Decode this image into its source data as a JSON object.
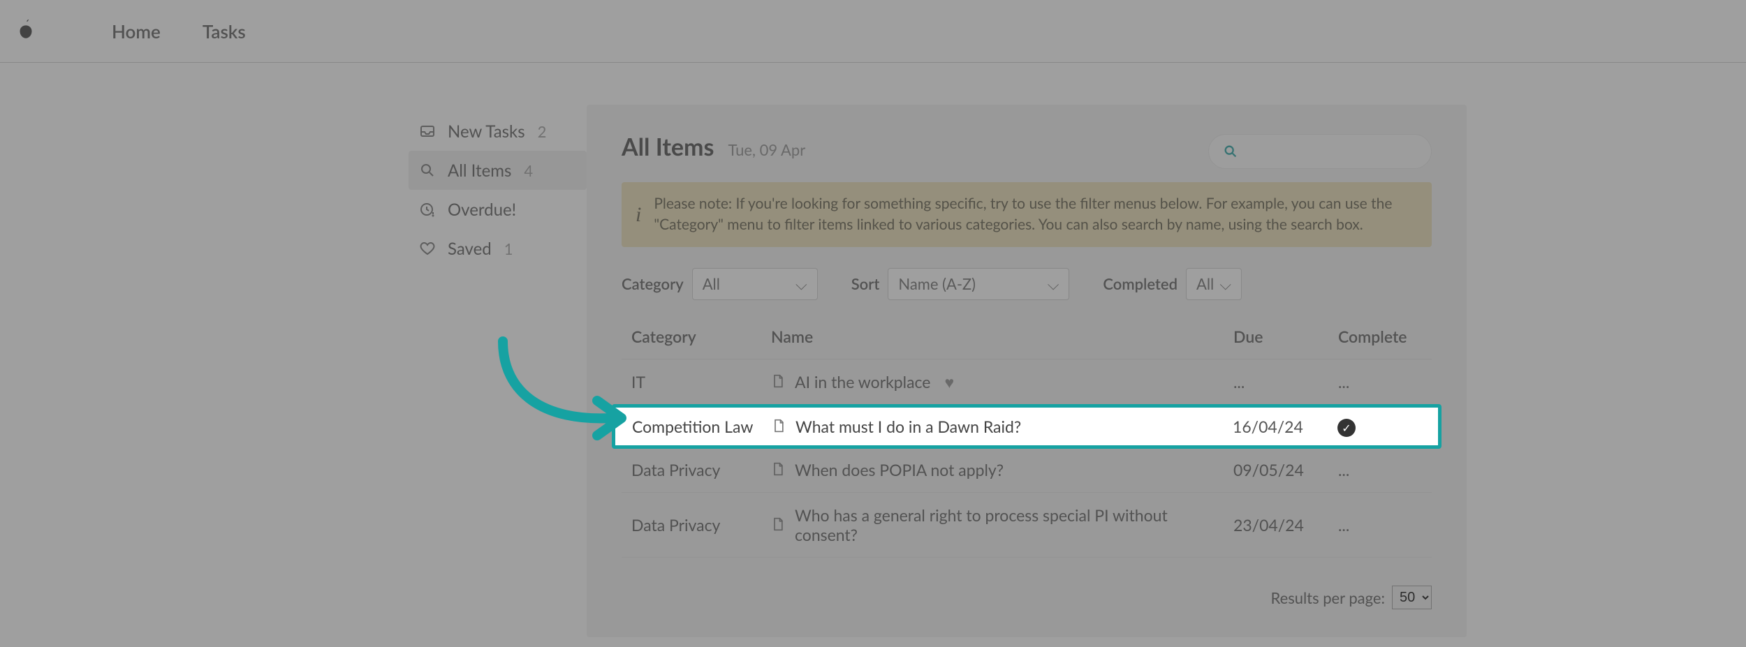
{
  "nav": {
    "home": "Home",
    "tasks": "Tasks"
  },
  "sidebar": {
    "items": [
      {
        "label": "New Tasks",
        "count": "2"
      },
      {
        "label": "All Items",
        "count": "4"
      },
      {
        "label": "Overdue!",
        "count": ""
      },
      {
        "label": "Saved",
        "count": "1"
      }
    ]
  },
  "page": {
    "title": "All Items",
    "date": "Tue, 09 Apr"
  },
  "banner": "Please note: If you're looking for something specific, try to use the filter menus below. For example, you can use the \"Category\" menu to filter items linked to various categories. You can also search by name, using the search box.",
  "filters": {
    "category_label": "Category",
    "category_value": "All",
    "sort_label": "Sort",
    "sort_value": "Name (A-Z)",
    "completed_label": "Completed",
    "completed_value": "All"
  },
  "table": {
    "head": {
      "category": "Category",
      "name": "Name",
      "due": "Due",
      "complete": "Complete"
    },
    "rows": [
      {
        "category": "IT",
        "name": "AI in the workplace",
        "due": "...",
        "complete": "...",
        "favorite": true,
        "completed_check": false
      },
      {
        "category": "Competition Law",
        "name": "What must I do in a Dawn Raid?",
        "due": "16/04/24",
        "complete": "",
        "favorite": false,
        "completed_check": true
      },
      {
        "category": "Data Privacy",
        "name": "When does POPIA not apply?",
        "due": "09/05/24",
        "complete": "...",
        "favorite": false,
        "completed_check": false
      },
      {
        "category": "Data Privacy",
        "name": "Who has a general right to process special PI without consent?",
        "due": "23/04/24",
        "complete": "...",
        "favorite": false,
        "completed_check": false
      }
    ]
  },
  "pager": {
    "label": "Results per page:",
    "value": "50"
  }
}
